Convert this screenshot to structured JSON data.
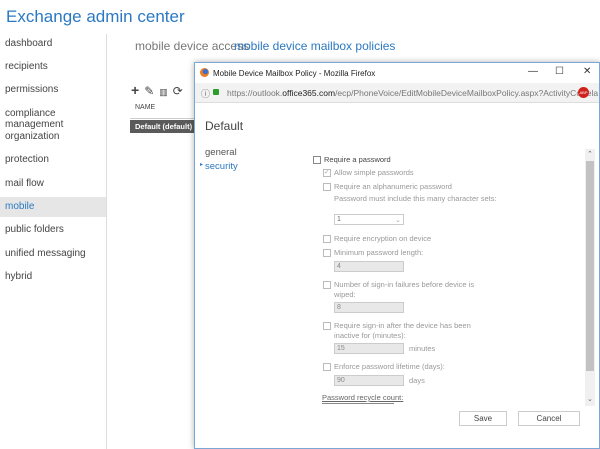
{
  "app_title": "Exchange admin center",
  "sidebar": {
    "items": [
      {
        "label": "dashboard"
      },
      {
        "label": "recipients"
      },
      {
        "label": "permissions"
      },
      {
        "label": "compliance management"
      },
      {
        "label": "organization"
      },
      {
        "label": "protection"
      },
      {
        "label": "mail flow"
      },
      {
        "label": "mobile",
        "selected": true
      },
      {
        "label": "public folders"
      },
      {
        "label": "unified messaging"
      },
      {
        "label": "hybrid"
      }
    ]
  },
  "tabs": [
    {
      "label": "mobile device access"
    },
    {
      "label": "mobile device mailbox policies",
      "active": true
    }
  ],
  "toolbar": {
    "icons": [
      "plus-icon",
      "pencil-icon",
      "trash-icon",
      "refresh-icon"
    ],
    "glyphs": "+✎🗑⟳"
  },
  "table": {
    "header": "NAME",
    "rows": [
      "Default (default)"
    ]
  },
  "popup": {
    "window_title": "Mobile Device Mailbox Policy - Mozilla Firefox",
    "url_prefix": "https://outlook.",
    "url_domain": "office365.com",
    "url_path": "/ecp/PhoneVoice/EditMobileDeviceMailboxPolicy.aspx?ActivityCorrela",
    "heading": "Default",
    "nav": [
      "general",
      "security"
    ],
    "form": {
      "require_password": "Require a password",
      "allow_simple": "Allow simple passwords",
      "alphanumeric": "Require an alphanumeric password",
      "char_sets_label": "Password must include this many character sets:",
      "char_sets_value": "1",
      "encryption": "Require encryption on device",
      "min_length": "Minimum password length:",
      "min_length_value": "4",
      "failures": "Number of sign-in failures before device is wiped:",
      "failures_value": "8",
      "inactive": "Require sign-in after the device has been inactive for (minutes):",
      "inactive_value": "15",
      "inactive_unit": "minutes",
      "lifetime": "Enforce password lifetime (days):",
      "lifetime_value": "90",
      "lifetime_unit": "days",
      "recycle": "Password recycle count:"
    },
    "save": "Save",
    "cancel": "Cancel"
  }
}
